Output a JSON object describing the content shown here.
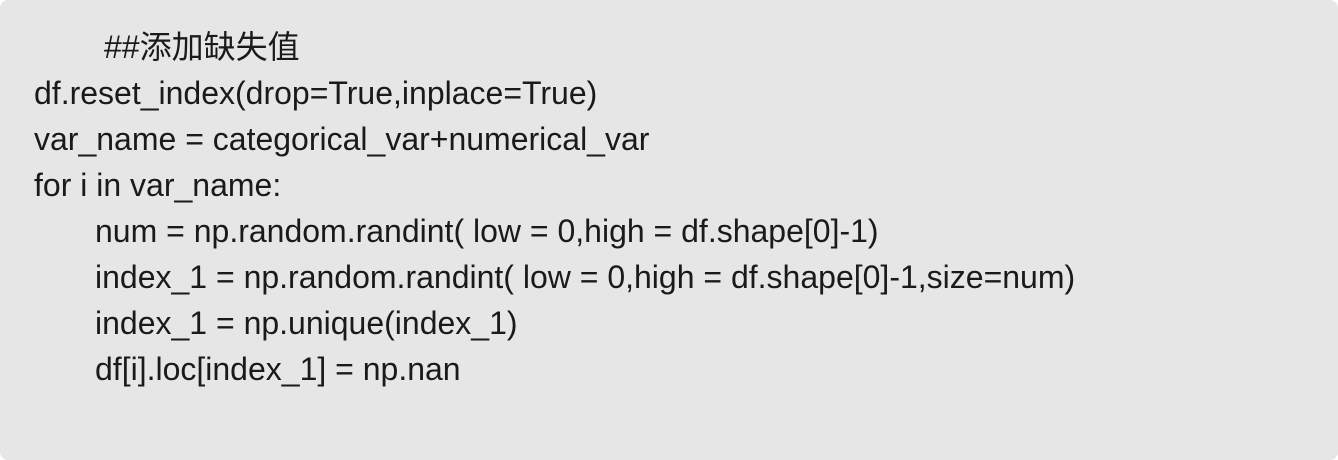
{
  "code": {
    "lines": [
      "##添加缺失值",
      "df.reset_index(drop=True,inplace=True)",
      "var_name = categorical_var+numerical_var",
      "for i in var_name:",
      "num = np.random.randint( low = 0,high = df.shape[0]-1)",
      "index_1 = np.random.randint( low = 0,high = df.shape[0]-1,size=num)",
      "index_1 = np.unique(index_1)",
      "df[i].loc[index_1] = np.nan"
    ]
  }
}
